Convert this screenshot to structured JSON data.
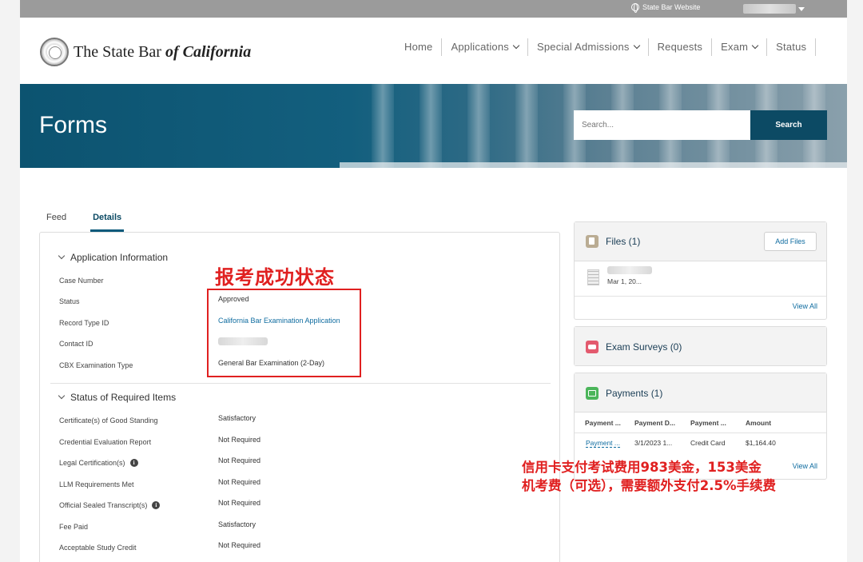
{
  "topbar": {
    "site_link": "State Bar Website"
  },
  "header": {
    "logo_prefix": "The State Bar ",
    "logo_of": "of",
    "logo_suffix": " California",
    "nav": [
      {
        "label": "Home",
        "dropdown": false
      },
      {
        "label": "Applications",
        "dropdown": true
      },
      {
        "label": "Special Admissions",
        "dropdown": true
      },
      {
        "label": "Requests",
        "dropdown": false
      },
      {
        "label": "Exam",
        "dropdown": true
      },
      {
        "label": "Status",
        "dropdown": false
      }
    ]
  },
  "banner": {
    "title": "Forms",
    "search_placeholder": "Search...",
    "search_button": "Search"
  },
  "tabs": {
    "feed": "Feed",
    "details": "Details"
  },
  "application_info": {
    "heading": "Application Information",
    "rows": [
      {
        "label": "Case Number",
        "value": ""
      },
      {
        "label": "Status",
        "value": "Approved"
      },
      {
        "label": "Record Type ID",
        "value": "California Bar Examination Application"
      },
      {
        "label": "Contact ID",
        "value": ""
      },
      {
        "label": "CBX Examination Type",
        "value": "General Bar Examination (2-Day)"
      }
    ]
  },
  "required_items": {
    "heading": "Status of Required Items",
    "rows": [
      {
        "label": "Certificate(s) of Good Standing",
        "value": "Satisfactory",
        "info": false
      },
      {
        "label": "Credential Evaluation Report",
        "value": "Not Required",
        "info": false
      },
      {
        "label": "Legal Certification(s)",
        "value": "Not Required",
        "info": true
      },
      {
        "label": "LLM Requirements Met",
        "value": "Not Required",
        "info": false
      },
      {
        "label": "Official Sealed Transcript(s)",
        "value": "Not Required",
        "info": true
      },
      {
        "label": "Fee Paid",
        "value": "Satisfactory",
        "info": false
      },
      {
        "label": "Acceptable Study Credit",
        "value": "Not Required",
        "info": false
      }
    ]
  },
  "annotations": {
    "status_note": "报考成功状态",
    "payment_note_line1": "信用卡支付考试费用983美金，153美金",
    "payment_note_line2": "机考费（可选），需要额外支付2.5%手续费"
  },
  "files_card": {
    "title": "Files (1)",
    "add_button": "Add Files",
    "file_date": "Mar 1, 20...",
    "view_all": "View All"
  },
  "surveys_card": {
    "title": "Exam Surveys (0)"
  },
  "payments_card": {
    "title": "Payments (1)",
    "columns": [
      "Payment ...",
      "Payment D...",
      "Payment ...",
      "Amount"
    ],
    "row": [
      "Payment ...",
      "3/1/2023 1...",
      "Credit Card",
      "$1,164.40"
    ],
    "view_all": "View All"
  },
  "colors": {
    "brand": "#0c4a64",
    "annotation": "#e02020",
    "link": "#0f6ca0"
  },
  "icons": [
    "globe-icon",
    "chevron-down-icon",
    "info-icon",
    "files-icon",
    "exam-survey-icon",
    "payments-icon",
    "file-document-icon"
  ]
}
